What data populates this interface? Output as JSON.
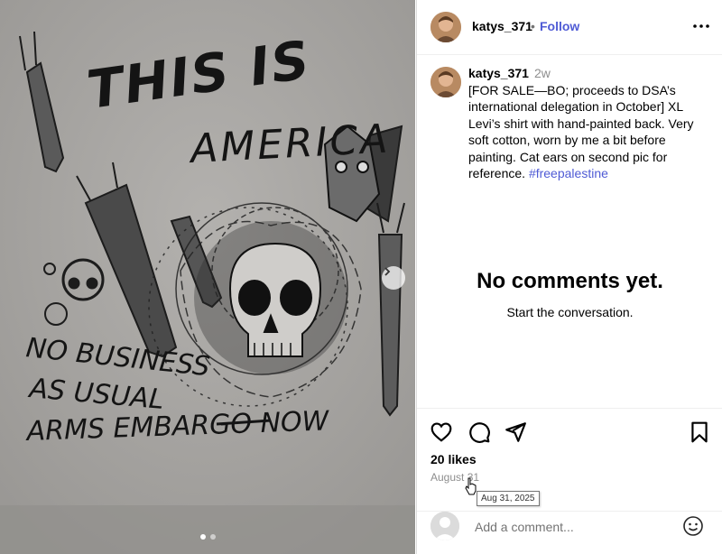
{
  "post": {
    "image": {
      "painted_text_lines": [
        "THIS IS",
        "AMERICA",
        "NO BUSINESS",
        "AS USUAL",
        "ARMS EMBARGO NOW"
      ],
      "carousel_dots": 2,
      "active_dot": 1
    },
    "header": {
      "username": "katys_371",
      "separator": "•",
      "follow_label": "Follow"
    },
    "caption": {
      "username": "katys_371",
      "age": "2w",
      "text": "[FOR SALE—BO; proceeds to DSA’s international delegation in October] XL Levi’s shirt with hand-painted back. Very soft cotton, worn by me a bit before painting. Cat ears on second pic for reference. ",
      "hashtag": "#freepalestine"
    },
    "comments": {
      "empty_title": "No comments yet.",
      "empty_subtitle": "Start the conversation."
    },
    "actions": {
      "icons": [
        "heart-icon",
        "comment-icon",
        "share-icon",
        "bookmark-icon"
      ]
    },
    "likes": "20 likes",
    "date": "August 31",
    "tooltip": "Aug 31, 2025",
    "add_comment": {
      "placeholder": "Add a comment..."
    },
    "colors": {
      "link": "#4f5bd5",
      "muted": "#8e8e8e",
      "border": "#dbdbdb"
    }
  }
}
